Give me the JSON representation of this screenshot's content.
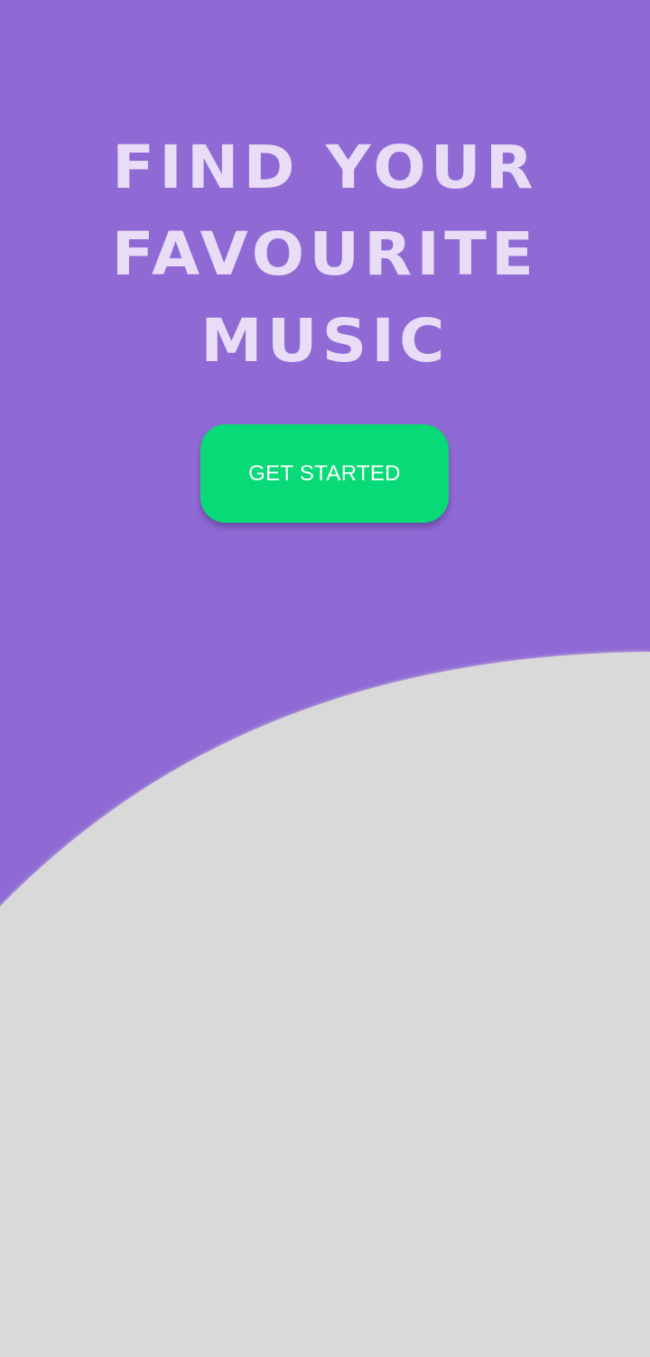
{
  "hero": {
    "headline_lines": [
      "FIND YOUR",
      "FAVOURITE",
      "MUSIC"
    ]
  },
  "cta": {
    "label": "GET STARTED"
  },
  "colors": {
    "background": "#8f6ad4",
    "headline": "#e8dcf6",
    "button": "#07da76",
    "button_text": "#ffffff",
    "curve_panel": "#d9d9d9"
  }
}
